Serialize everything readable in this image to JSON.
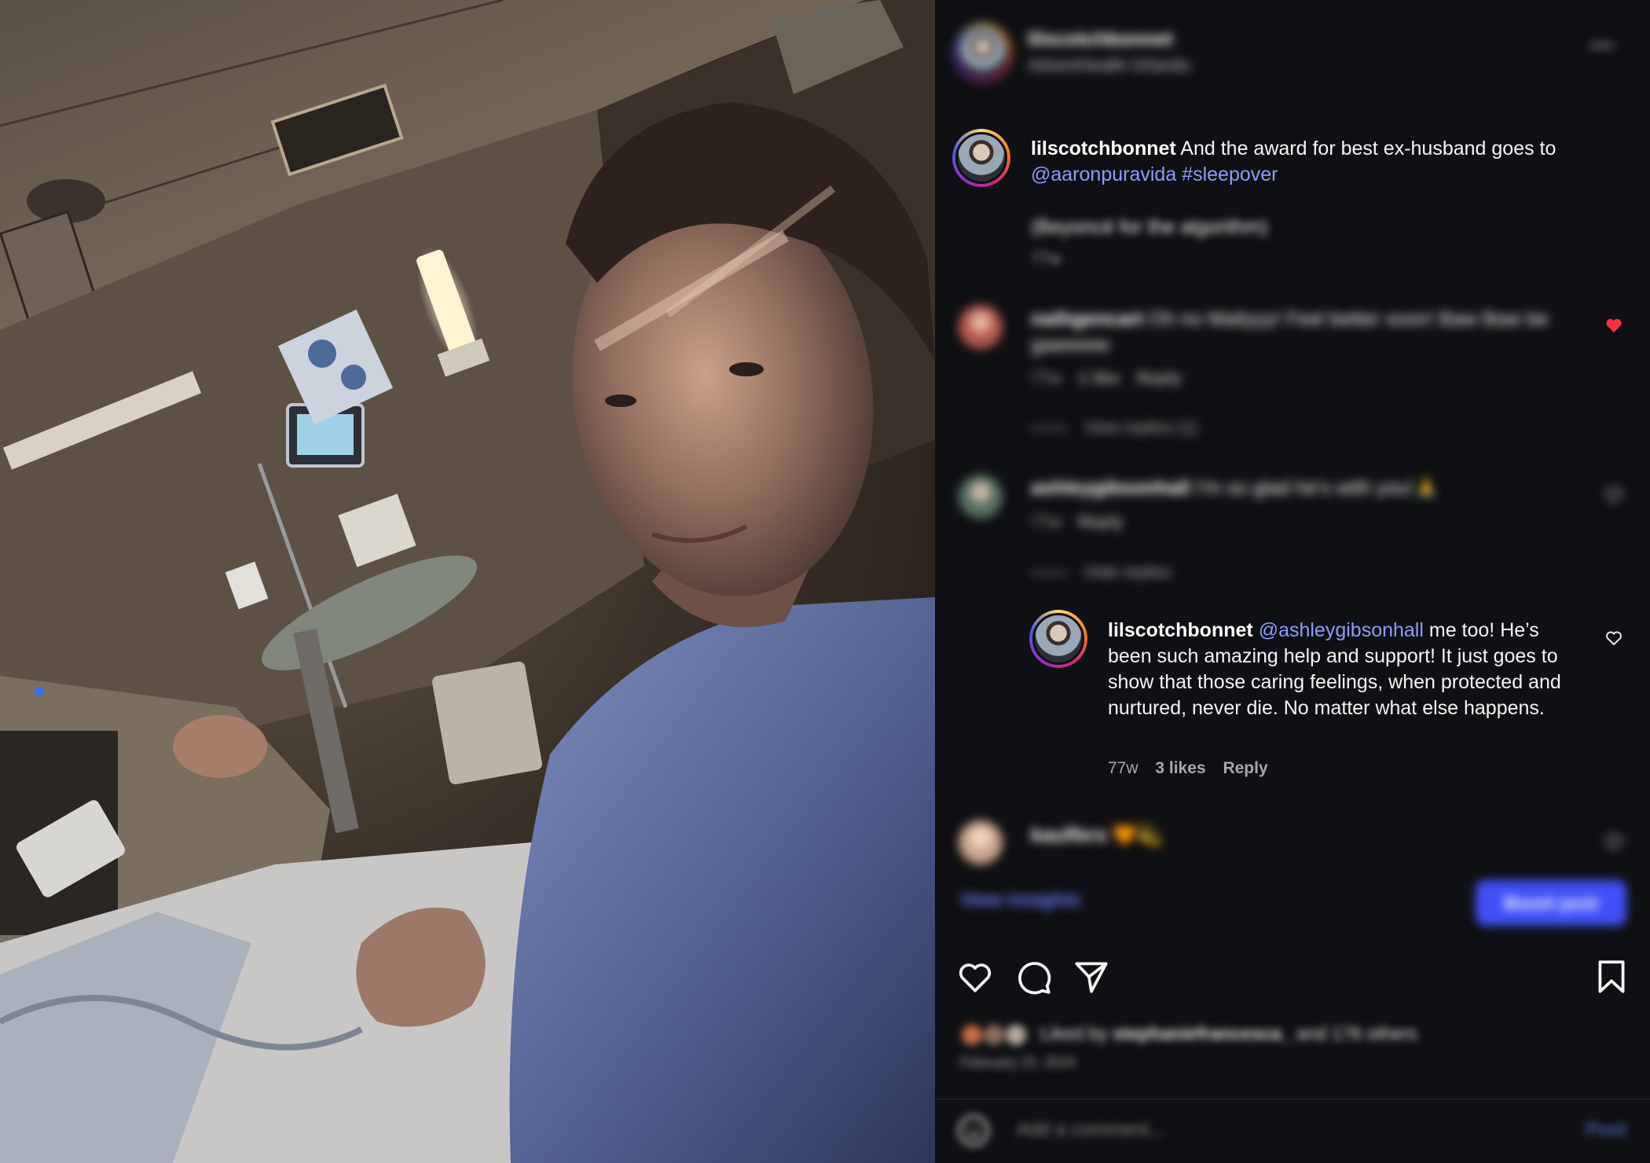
{
  "post": {
    "username": "lilscotchbonnet",
    "location": "AdventHealth Orlando"
  },
  "caption": {
    "username": "lilscotchbonnet",
    "text": " And the award for best ex-husband goes to ",
    "mention": "@aaronpuravida",
    "hashtag": "#sleepover",
    "extra_line": "(Beyoncé for the algorithm)",
    "time": "77w"
  },
  "comments": [
    {
      "username": "nathgencart",
      "text": " Oh no Mattyyy! Feel better soon! Baw Baw be gawwww",
      "time": "77w",
      "likes": "1 like",
      "reply": "Reply",
      "view_replies": "View replies (1)",
      "avatar_color": "#b4574f",
      "liked": true
    },
    {
      "username": "ashleygibsonhall",
      "text": " I'm so glad he's with you!🙏",
      "time": "77w",
      "reply": "Reply",
      "hide_replies": "Hide replies",
      "avatar_color": "#5a6f62"
    }
  ],
  "reply": {
    "username": "lilscotchbonnet",
    "mention": "@ashleygibsonhall",
    "text": " me too! He’s been such amazing help and support! It just goes to show that those caring feelings, when protected and nurtured, never die. No matter what else happens.",
    "time": "77w",
    "likes": "3 likes",
    "reply": "Reply"
  },
  "comment_last": {
    "username": "kauffers",
    "text": " 🧡💫",
    "avatar_color": "#c8a48a"
  },
  "actions": {
    "view_insights": "View insights",
    "boost_post": "Boost post",
    "icons": [
      "heart-icon",
      "comment-icon",
      "share-icon",
      "bookmark-icon"
    ]
  },
  "likes": {
    "prefix": "Liked by ",
    "user": "stephaniefrancesca_",
    "suffix": " and 176 others"
  },
  "date": "February 23, 2024",
  "composer": {
    "placeholder": "Add a comment...",
    "post_label": "Post"
  },
  "colors": {
    "panel_bg": "#0f1013",
    "link": "#8e9bff",
    "boost": "#4150f7",
    "liked_heart": "#ff3040"
  }
}
